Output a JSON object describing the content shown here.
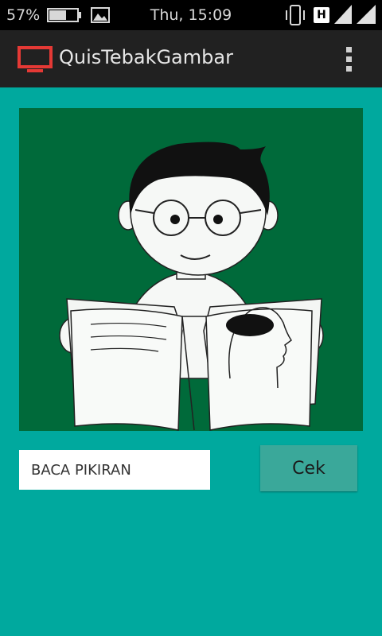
{
  "status_bar": {
    "battery_percent": "57%",
    "clock": "Thu, 15:09",
    "network_type": "H",
    "icons": [
      "battery-icon",
      "gallery-icon",
      "vibrate-icon",
      "network-h-icon",
      "signal-icon",
      "signal-icon"
    ]
  },
  "action_bar": {
    "title": "QuisTebakGambar",
    "icons": [
      "tv-app-icon",
      "overflow-menu-icon"
    ]
  },
  "quiz": {
    "image_subject": "boy-reading-book-icon",
    "answer_value": "BACA PIKIRAN",
    "check_label": "Cek"
  },
  "colors": {
    "content_bg": "#00a99e",
    "picture_bg": "#006a3a",
    "button_bg": "#3aa89a",
    "app_icon": "#e53935"
  }
}
